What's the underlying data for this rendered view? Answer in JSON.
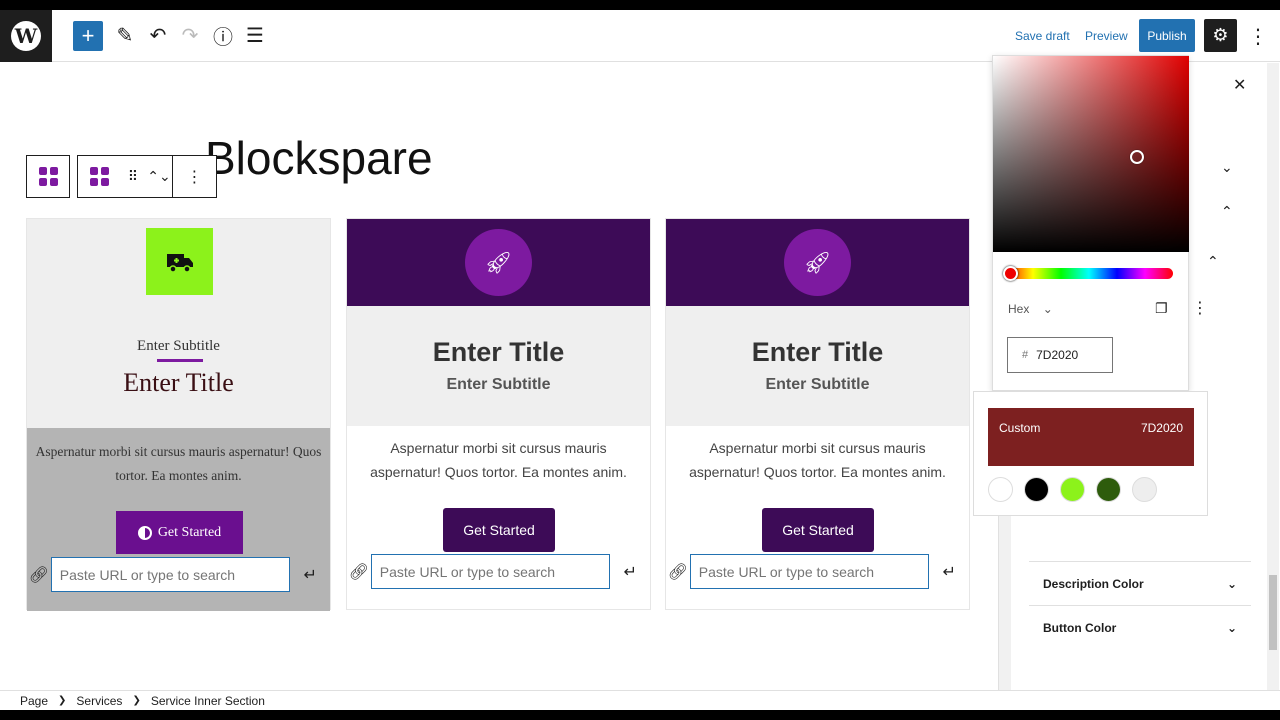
{
  "toolbar": {
    "logo": "W",
    "add_icon": "+",
    "edit_icon": "✎",
    "undo_icon": "↶",
    "redo_icon": "↷",
    "info_icon": "ⓘ",
    "list_icon": "☰",
    "save_draft": "Save draft",
    "preview": "Preview",
    "publish": "Publish",
    "settings_icon": "⚙",
    "more_icon": "⋮"
  },
  "editor": {
    "page_title": "Blockspare",
    "block_toolbar": {
      "drag_icon": "⠿",
      "move_icon": "⌃⌄",
      "more_icon": "⋮"
    },
    "cards": [
      {
        "icon": "truck-medical",
        "subtitle": "Enter Subtitle",
        "title": "Enter Title",
        "description": "Aspernatur morbi sit cursus mauris aspernatur! Quos tortor. Ea montes anim.",
        "button": "Get Started",
        "url_placeholder": "Paste URL or type to search",
        "accent": "#8CF21B"
      },
      {
        "icon": "rocket",
        "title": "Enter Title",
        "subtitle": "Enter Subtitle",
        "description": "Aspernatur morbi sit cursus mauris aspernatur! Quos tortor. Ea montes anim.",
        "button": "Get Started",
        "url_placeholder": "Paste URL or type to search",
        "accent": "#3D0B57"
      },
      {
        "icon": "rocket",
        "title": "Enter Title",
        "subtitle": "Enter Subtitle",
        "description": "Aspernatur morbi sit cursus mauris aspernatur! Quos tortor. Ea montes anim.",
        "button": "Get Started",
        "url_placeholder": "Paste URL or type to search",
        "accent": "#3D0B57"
      }
    ]
  },
  "breadcrumb": [
    "Page",
    "Services",
    "Service Inner Section"
  ],
  "sidebar": {
    "close_icon": "✕",
    "rows": [
      "Description Color",
      "Button Color"
    ]
  },
  "color_picker": {
    "format_label": "Hex",
    "format_chevron": "⌄",
    "hex_prefix": "#",
    "hex_value": "7D2020",
    "custom_label": "Custom",
    "custom_value": "7D2020",
    "custom_color": "#7D2020",
    "swatches": [
      "#FFFFFF",
      "#000000",
      "#8CF21B",
      "#2E5C0C",
      "#EEEEEE"
    ]
  }
}
